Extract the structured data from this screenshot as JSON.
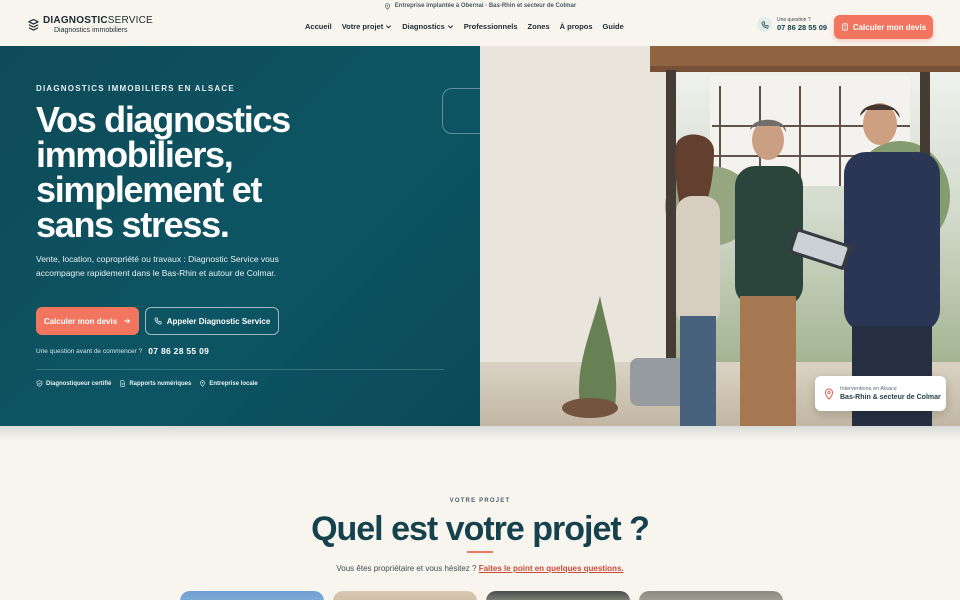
{
  "topstrip": {
    "text": "Entreprise implantée à Obernai · Bas-Rhin et secteur de Colmar",
    "icon": "map-pin-icon"
  },
  "header": {
    "logo_brand_bold": "DIAGNOSTIC",
    "logo_brand_light": "SERVICE",
    "logo_sub": "Diagnostics immobiliers",
    "nav": [
      {
        "label": "Accueil",
        "has_dropdown": false
      },
      {
        "label": "Votre projet",
        "has_dropdown": true
      },
      {
        "label": "Diagnostics",
        "has_dropdown": true
      },
      {
        "label": "Professionnels",
        "has_dropdown": false
      },
      {
        "label": "Zones",
        "has_dropdown": false
      },
      {
        "label": "À propos",
        "has_dropdown": false
      },
      {
        "label": "Guide",
        "has_dropdown": false
      }
    ],
    "phone_label": "Une question ?",
    "phone_number": "07 86 28 55 09",
    "cta_label": "Calculer mon devis"
  },
  "hero": {
    "eyebrow": "DIAGNOSTICS IMMOBILIERS EN ALSACE",
    "title": "Vos diagnostics immobiliers, simplement et sans stress.",
    "description": "Vente, location, copropriété ou travaux : Diagnostic Service vous accompagne rapidement dans le Bas-Rhin et autour de Colmar.",
    "primary_button": "Calculer mon devis",
    "secondary_button": "Appeler Diagnostic Service",
    "question_text": "Une question avant de commencer ?",
    "question_phone": "07 86 28 55 09",
    "badges": [
      {
        "label": "Diagnostiqueur certifié",
        "icon": "shield-check-icon"
      },
      {
        "label": "Rapports numériques",
        "icon": "document-icon"
      },
      {
        "label": "Entreprise locale",
        "icon": "map-pin-icon"
      }
    ],
    "location_card": {
      "small": "Interventions en Alsace",
      "main": "Bas-Rhin & secteur de Colmar"
    }
  },
  "section": {
    "eyebrow": "VOTRE PROJET",
    "title": "Quel est votre projet ?",
    "subtitle": "Vous êtes propriétaire et vous hésitez ?",
    "subtitle_link": "Faites le point en quelques questions."
  },
  "colors": {
    "primary": "#0f4a57",
    "accent": "#f2765f",
    "background": "#f8f5ef",
    "title": "#16424d"
  }
}
